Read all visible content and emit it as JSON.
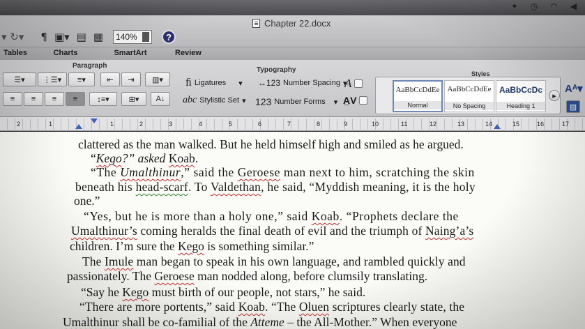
{
  "window": {
    "title": "Chapter 22.docx"
  },
  "toolbar": {
    "zoom_value": "140%",
    "help_label": "?"
  },
  "tabs": [
    {
      "label": "Tables"
    },
    {
      "label": "Charts"
    },
    {
      "label": "SmartArt"
    },
    {
      "label": "Review"
    }
  ],
  "ribbon": {
    "paragraph_label": "Paragraph",
    "typography_label": "Typography",
    "styles_label": "Styles",
    "ligatures": "Ligatures",
    "number_spacing": "Number Spacing",
    "stylistic_set": "Stylistic Set",
    "number_forms": "Number Forms",
    "styles": [
      {
        "sample": "AaBbCcDdEe",
        "name": "Normal"
      },
      {
        "sample": "AaBbCcDdEe",
        "name": "No Spacing"
      },
      {
        "sample": "AaBbCcDc",
        "name": "Heading 1"
      }
    ]
  },
  "ruler": {
    "labels": [
      "2",
      "1",
      "1",
      "2",
      "3",
      "4",
      "5",
      "6",
      "7",
      "8",
      "9",
      "10",
      "11",
      "12",
      "13",
      "14",
      "15",
      "16",
      "17"
    ]
  },
  "document": {
    "l1": "clattered as the man walked. But he held himself high and smiled as he argued.",
    "l2a": "“",
    "l2b": "Kego",
    "l2c": "?” asked ",
    "l2d": "Koab",
    "l2e": ".",
    "l3a": "“The ",
    "l3b": "Umalthinur",
    "l3c": ",” said the ",
    "l3d": "Geroese",
    "l3e": " man next to him, scratching the skin",
    "l4a": "beneath his ",
    "l4b": "head-scarf",
    "l4c": ". To ",
    "l4d": "Valdethan",
    "l4e": ", he said, “Myddish meaning, it is the holy",
    "l5": "one.”",
    "l6a": "“Yes, but he is more than a holy one,” said ",
    "l6b": "Koab",
    "l6c": ". “Prophets declare the",
    "l7a": "Umalthinur’s",
    "l7b": " coming heralds the final death of evil and the triumph of ",
    "l7c": "Naing’a’s",
    "l8a": "children. I’m sure the ",
    "l8b": "Kego",
    "l8c": " is something similar.”",
    "l9a": "The ",
    "l9b": "Imule",
    "l9c": " man began to speak in his own language, and rambled quickly and",
    "l10a": "passionately. The ",
    "l10b": "Geroese",
    "l10c": " man nodded along, before clumsily translating.",
    "l11a": "“Say he ",
    "l11b": "Kego",
    "l11c": " must birth of our people, not stars,” he said.",
    "l12a": "“There are more portents,” said ",
    "l12b": "Koab",
    "l12c": ". “The ",
    "l12d": "Oluen",
    "l12e": " scriptures clearly state, the",
    "l13a": "Umalthinur",
    "l13b": " shall be co-familial of the ",
    "l13c": "Atteme",
    "l13d": " – the All-Mother.” When everyone"
  }
}
